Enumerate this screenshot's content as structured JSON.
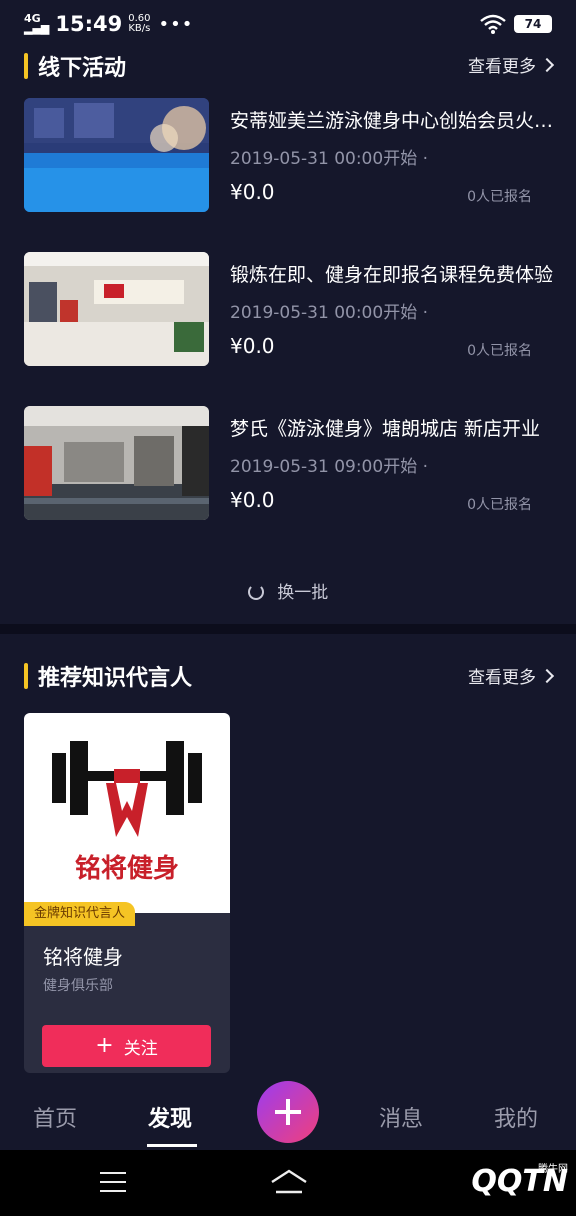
{
  "status": {
    "signal": "4G",
    "time": "15:49",
    "speed_value": "0.60",
    "speed_unit": "KB/s",
    "dots": "•••",
    "battery": "74"
  },
  "offline": {
    "title": "线下活动",
    "more": "查看更多",
    "events": [
      {
        "title": "安蒂娅美兰游泳健身中心创始会员火热招募中",
        "date": "2019-05-31 00:00开始 ·",
        "price": "¥0.0",
        "signed": "0人已报名"
      },
      {
        "title": "锻炼在即、健身在即报名课程免费体验",
        "date": "2019-05-31 00:00开始 ·",
        "price": "¥0.0",
        "signed": "0人已报名"
      },
      {
        "title": "梦氏《游泳健身》塘朗城店 新店开业",
        "date": "2019-05-31 09:00开始 ·",
        "price": "¥0.0",
        "signed": "0人已报名"
      }
    ],
    "refresh": "换一批"
  },
  "recommend": {
    "title": "推荐知识代言人",
    "more": "查看更多",
    "card": {
      "logo_text": "铭将健身",
      "badge": "金牌知识代言人",
      "name": "铭将健身",
      "sub": "健身俱乐部",
      "follow": "关注"
    }
  },
  "tabs": [
    "首页",
    "发现",
    "消息",
    "我的"
  ],
  "watermark": {
    "brand": "QQTN",
    "site": "腾牛网"
  },
  "colors": {
    "accent": "#f5c424",
    "follow": "#f02d5a",
    "bg": "#15172b"
  }
}
